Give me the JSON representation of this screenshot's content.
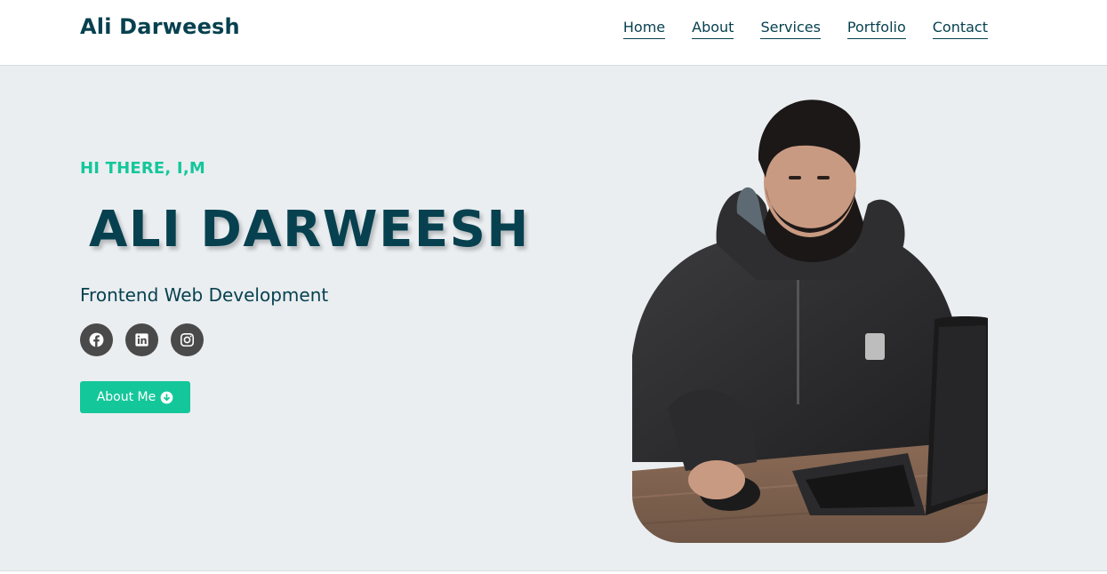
{
  "header": {
    "brand": "Ali Darweesh",
    "nav": [
      {
        "label": "Home"
      },
      {
        "label": "About"
      },
      {
        "label": "Services"
      },
      {
        "label": "Portfolio"
      },
      {
        "label": "Contact"
      }
    ]
  },
  "hero": {
    "greeting": "HI THERE, I,M",
    "name": "ALI DARWEESH",
    "role": "Frontend Web Development",
    "socials": [
      {
        "icon": "facebook-icon"
      },
      {
        "icon": "linkedin-icon"
      },
      {
        "icon": "instagram-icon"
      }
    ],
    "cta_label": "About Me",
    "cta_icon": "arrow-down-circle-icon",
    "photo_icon": "portrait-photo"
  },
  "colors": {
    "primary": "#07414f",
    "accent": "#14c79a",
    "hero_bg": "#eaeef1",
    "social_bg": "#4a4a4a"
  }
}
